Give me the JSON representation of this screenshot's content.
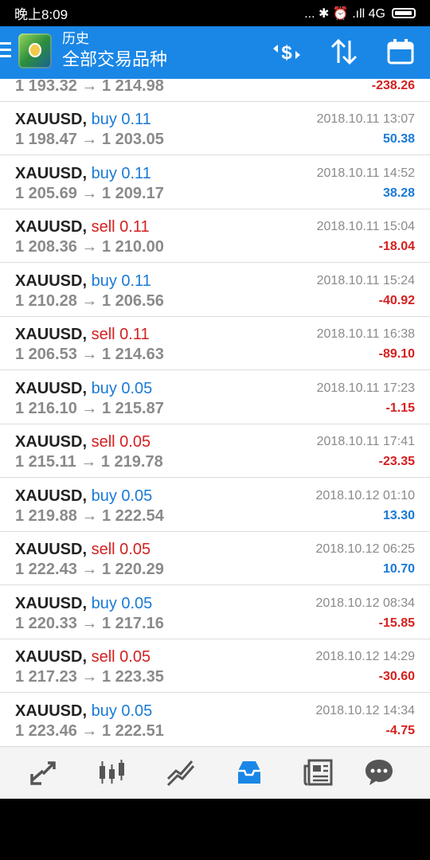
{
  "status_bar": {
    "time": "晚上8:09",
    "indicators": "... ✱ ⏰ .ıll 4G"
  },
  "header": {
    "title": "历史",
    "subtitle": "全部交易品种",
    "icons": [
      "menu-icon",
      "mt-logo-icon",
      "currency-filter-icon",
      "sort-icon",
      "calendar-icon"
    ]
  },
  "partial_row": {
    "prices": "1 193.32 → 1 214.98",
    "profit": "-238.26"
  },
  "trades": [
    {
      "symbol": "XAUUSD,",
      "side": "buy 0.11",
      "type": "buy",
      "prices": "1 198.47 → 1 203.05",
      "date": "2018.10.11 13:07",
      "profit": "50.38",
      "sign": "pos"
    },
    {
      "symbol": "XAUUSD,",
      "side": "buy 0.11",
      "type": "buy",
      "prices": "1 205.69 → 1 209.17",
      "date": "2018.10.11 14:52",
      "profit": "38.28",
      "sign": "pos"
    },
    {
      "symbol": "XAUUSD,",
      "side": "sell 0.11",
      "type": "sell",
      "prices": "1 208.36 → 1 210.00",
      "date": "2018.10.11 15:04",
      "profit": "-18.04",
      "sign": "neg"
    },
    {
      "symbol": "XAUUSD,",
      "side": "buy 0.11",
      "type": "buy",
      "prices": "1 210.28 → 1 206.56",
      "date": "2018.10.11 15:24",
      "profit": "-40.92",
      "sign": "neg"
    },
    {
      "symbol": "XAUUSD,",
      "side": "sell 0.11",
      "type": "sell",
      "prices": "1 206.53 → 1 214.63",
      "date": "2018.10.11 16:38",
      "profit": "-89.10",
      "sign": "neg"
    },
    {
      "symbol": "XAUUSD,",
      "side": "buy 0.05",
      "type": "buy",
      "prices": "1 216.10 → 1 215.87",
      "date": "2018.10.11 17:23",
      "profit": "-1.15",
      "sign": "neg"
    },
    {
      "symbol": "XAUUSD,",
      "side": "sell 0.05",
      "type": "sell",
      "prices": "1 215.11 → 1 219.78",
      "date": "2018.10.11 17:41",
      "profit": "-23.35",
      "sign": "neg"
    },
    {
      "symbol": "XAUUSD,",
      "side": "buy 0.05",
      "type": "buy",
      "prices": "1 219.88 → 1 222.54",
      "date": "2018.10.12 01:10",
      "profit": "13.30",
      "sign": "pos"
    },
    {
      "symbol": "XAUUSD,",
      "side": "sell 0.05",
      "type": "sell",
      "prices": "1 222.43 → 1 220.29",
      "date": "2018.10.12 06:25",
      "profit": "10.70",
      "sign": "pos"
    },
    {
      "symbol": "XAUUSD,",
      "side": "buy 0.05",
      "type": "buy",
      "prices": "1 220.33 → 1 217.16",
      "date": "2018.10.12 08:34",
      "profit": "-15.85",
      "sign": "neg"
    },
    {
      "symbol": "XAUUSD,",
      "side": "sell 0.05",
      "type": "sell",
      "prices": "1 217.23 → 1 223.35",
      "date": "2018.10.12 14:29",
      "profit": "-30.60",
      "sign": "neg"
    },
    {
      "symbol": "XAUUSD,",
      "side": "buy 0.05",
      "type": "buy",
      "prices": "1 223.46 → 1 222.51",
      "date": "2018.10.12 14:34",
      "profit": "-4.75",
      "sign": "neg"
    }
  ],
  "bottom_nav": {
    "items": [
      "quotes-icon",
      "chart-icon",
      "trade-icon",
      "history-icon",
      "news-icon",
      "chat-icon"
    ],
    "active": "history-icon"
  },
  "colors": {
    "appbar": "#1a87e6",
    "buy": "#1a7ad6",
    "sell": "#d42020",
    "profit_positive": "#1a7ad6",
    "profit_negative": "#d42020"
  }
}
